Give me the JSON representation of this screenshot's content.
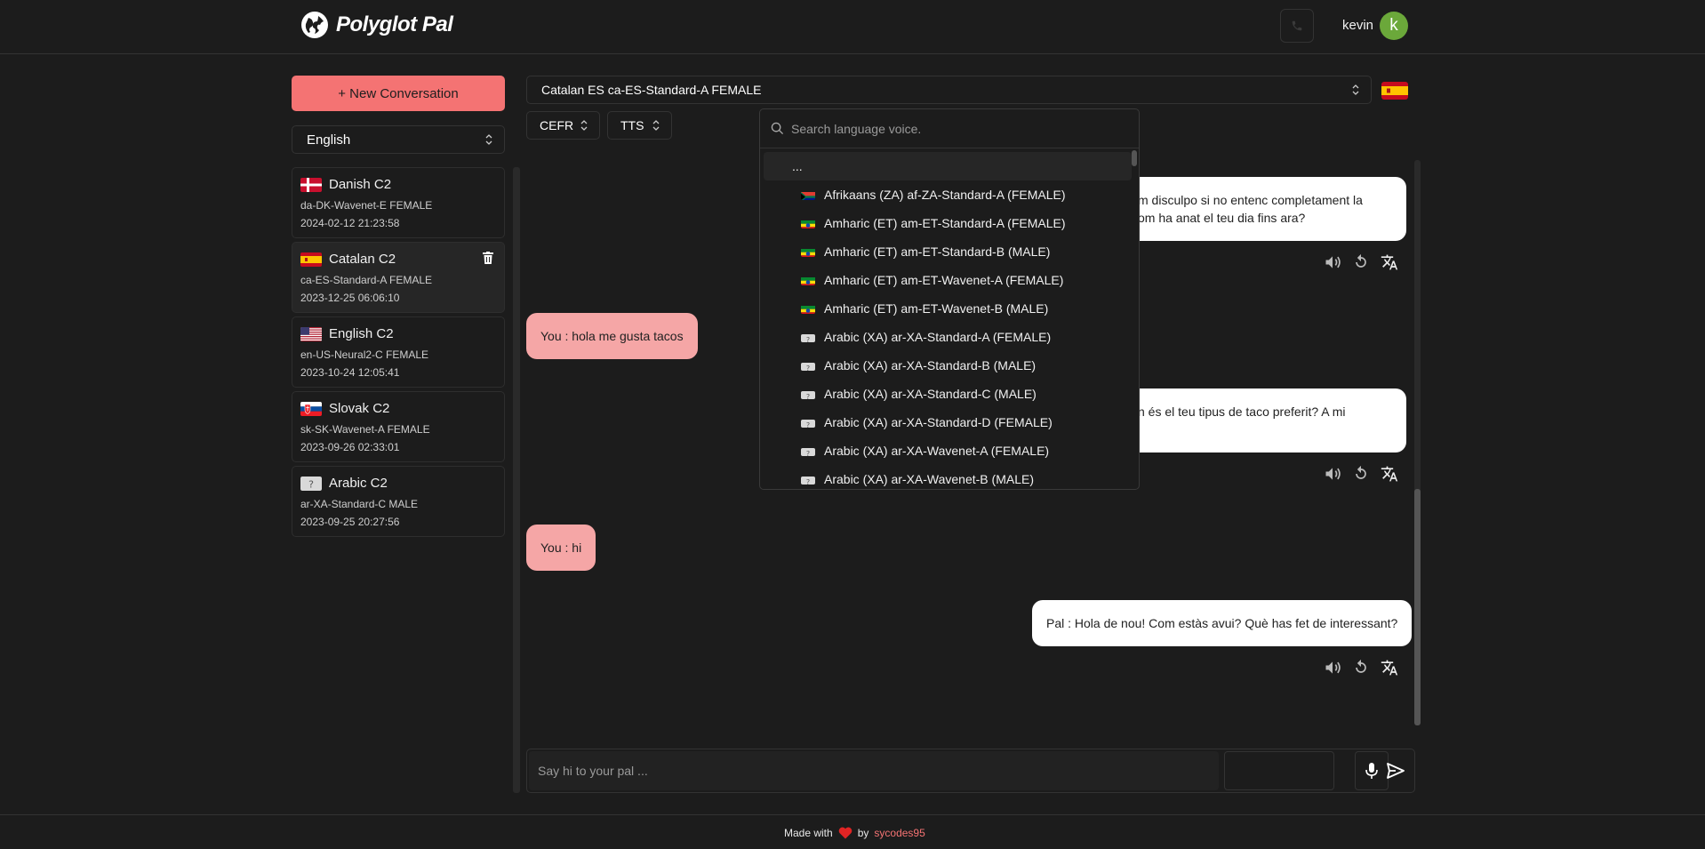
{
  "header": {
    "app_name": "Polyglot Pal",
    "username": "kevin",
    "avatar_letter": "k"
  },
  "sidebar": {
    "new_conversation_label": "+ New Conversation",
    "ui_language": "English",
    "conversations": [
      {
        "title": "Danish C2",
        "voice": "da-DK-Wavenet-E FEMALE",
        "date": "2024-02-12 21:23:58",
        "flag": "dk"
      },
      {
        "title": "Catalan C2",
        "voice": "ca-ES-Standard-A FEMALE",
        "date": "2023-12-25 06:06:10",
        "flag": "es",
        "active": true
      },
      {
        "title": "English C2",
        "voice": "en-US-Neural2-C FEMALE",
        "date": "2023-10-24 12:05:41",
        "flag": "us"
      },
      {
        "title": "Slovak C2",
        "voice": "sk-SK-Wavenet-A FEMALE",
        "date": "2023-09-26 02:33:01",
        "flag": "sk"
      },
      {
        "title": "Arabic C2",
        "voice": "ar-XA-Standard-C MALE",
        "date": "2023-09-25 20:27:56",
        "flag": "unknown"
      }
    ]
  },
  "main": {
    "voice_selected": "Catalan ES ca-ES-Standard-A FEMALE",
    "cefr_label": "CEFR",
    "tts_label": "TTS",
    "messages": [
      {
        "role": "pal",
        "line1": "m disculpo si no entenc completament la",
        "line2": "om ha anat el teu dia fins ara?"
      },
      {
        "role": "user",
        "text": "You : hola me gusta tacos"
      },
      {
        "role": "pal",
        "line1": "n és el teu tipus de taco preferit? A mi",
        "line2": ""
      },
      {
        "role": "user",
        "text": "You : hi"
      },
      {
        "role": "pal",
        "text": "Pal : Hola de nou! Com estàs avui? Què has fet de interessant?"
      }
    ]
  },
  "voice_dropdown": {
    "search_placeholder": "Search language voice.",
    "first_item": "...",
    "items": [
      {
        "label": "Afrikaans (ZA) af-ZA-Standard-A (FEMALE)",
        "flag": "za"
      },
      {
        "label": "Amharic (ET) am-ET-Standard-A (FEMALE)",
        "flag": "et"
      },
      {
        "label": "Amharic (ET) am-ET-Standard-B (MALE)",
        "flag": "et"
      },
      {
        "label": "Amharic (ET) am-ET-Wavenet-A (FEMALE)",
        "flag": "et"
      },
      {
        "label": "Amharic (ET) am-ET-Wavenet-B (MALE)",
        "flag": "et"
      },
      {
        "label": "Arabic (XA) ar-XA-Standard-A (FEMALE)",
        "flag": "unknown"
      },
      {
        "label": "Arabic (XA) ar-XA-Standard-B (MALE)",
        "flag": "unknown"
      },
      {
        "label": "Arabic (XA) ar-XA-Standard-C (MALE)",
        "flag": "unknown"
      },
      {
        "label": "Arabic (XA) ar-XA-Standard-D (FEMALE)",
        "flag": "unknown"
      },
      {
        "label": "Arabic (XA) ar-XA-Wavenet-A (FEMALE)",
        "flag": "unknown"
      },
      {
        "label": "Arabic (XA) ar-XA-Wavenet-B (MALE)",
        "flag": "unknown"
      }
    ]
  },
  "composer": {
    "placeholder": "Say hi to your pal ..."
  },
  "footer": {
    "made_with": "Made with",
    "by": "by",
    "author": "sycodes95"
  },
  "colors": {
    "accent": "#f47373",
    "user_bubble": "#f5a6a6",
    "pal_bubble": "#ffffff",
    "avatar": "#6ba83a",
    "background": "#1c1c1c"
  },
  "icons": [
    "globe-icon",
    "phone-icon",
    "chevron-updown-icon",
    "trash-icon",
    "speaker-icon",
    "replay-icon",
    "translate-icon",
    "search-icon",
    "mic-icon",
    "send-icon",
    "heart-icon"
  ]
}
